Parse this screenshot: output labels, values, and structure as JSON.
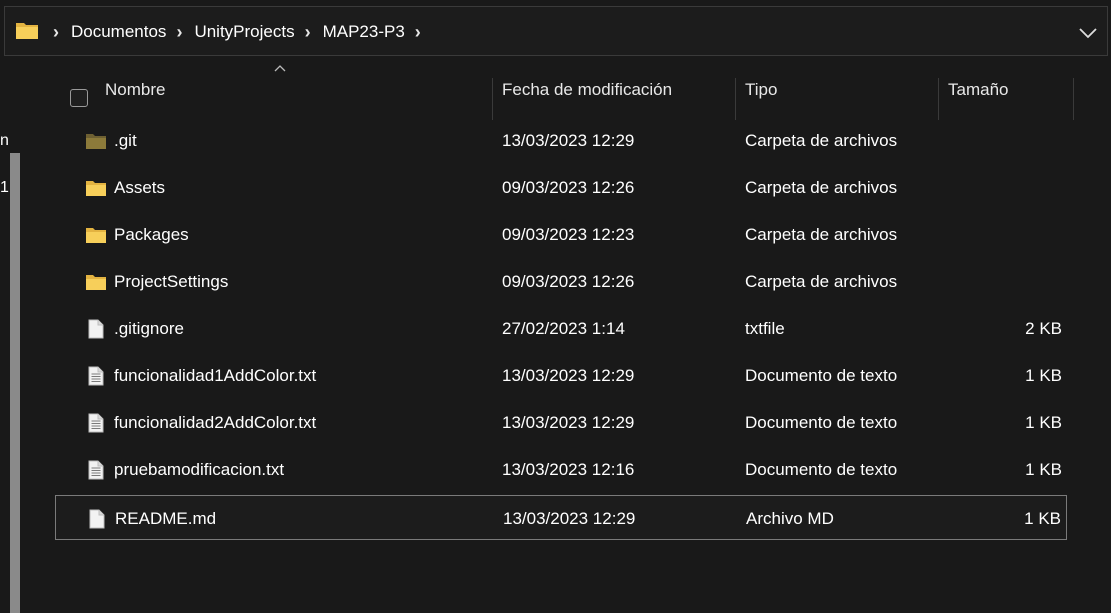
{
  "breadcrumb": {
    "items": [
      "Documentos",
      "UnityProjects",
      "MAP23-P3"
    ]
  },
  "nav_fragments": [
    "n",
    "1"
  ],
  "columns": {
    "name": "Nombre",
    "date": "Fecha de modificación",
    "type": "Tipo",
    "size": "Tamaño"
  },
  "files": [
    {
      "name": ".git",
      "date": "13/03/2023 12:29",
      "type": "Carpeta de archivos",
      "size": "",
      "icon": "folder-icon-dim"
    },
    {
      "name": "Assets",
      "date": "09/03/2023 12:26",
      "type": "Carpeta de archivos",
      "size": "",
      "icon": "folder-icon"
    },
    {
      "name": "Packages",
      "date": "09/03/2023 12:23",
      "type": "Carpeta de archivos",
      "size": "",
      "icon": "folder-icon"
    },
    {
      "name": "ProjectSettings",
      "date": "09/03/2023 12:26",
      "type": "Carpeta de archivos",
      "size": "",
      "icon": "folder-icon"
    },
    {
      "name": ".gitignore",
      "date": "27/02/2023 1:14",
      "type": "txtfile",
      "size": "2 KB",
      "icon": "blank-file-icon"
    },
    {
      "name": "funcionalidad1AddColor.txt",
      "date": "13/03/2023 12:29",
      "type": "Documento de texto",
      "size": "1 KB",
      "icon": "text-file-icon"
    },
    {
      "name": "funcionalidad2AddColor.txt",
      "date": "13/03/2023 12:29",
      "type": "Documento de texto",
      "size": "1 KB",
      "icon": "text-file-icon"
    },
    {
      "name": "pruebamodificacion.txt",
      "date": "13/03/2023 12:16",
      "type": "Documento de texto",
      "size": "1 KB",
      "icon": "text-file-icon"
    },
    {
      "name": "README.md",
      "date": "13/03/2023 12:29",
      "type": "Archivo MD",
      "size": "1 KB",
      "icon": "blank-file-icon"
    }
  ],
  "colors": {
    "background": "#191919",
    "folder": "#f2c94c",
    "folder_dim": "#8c7a3a",
    "selection_border": "#7a7a7a"
  }
}
